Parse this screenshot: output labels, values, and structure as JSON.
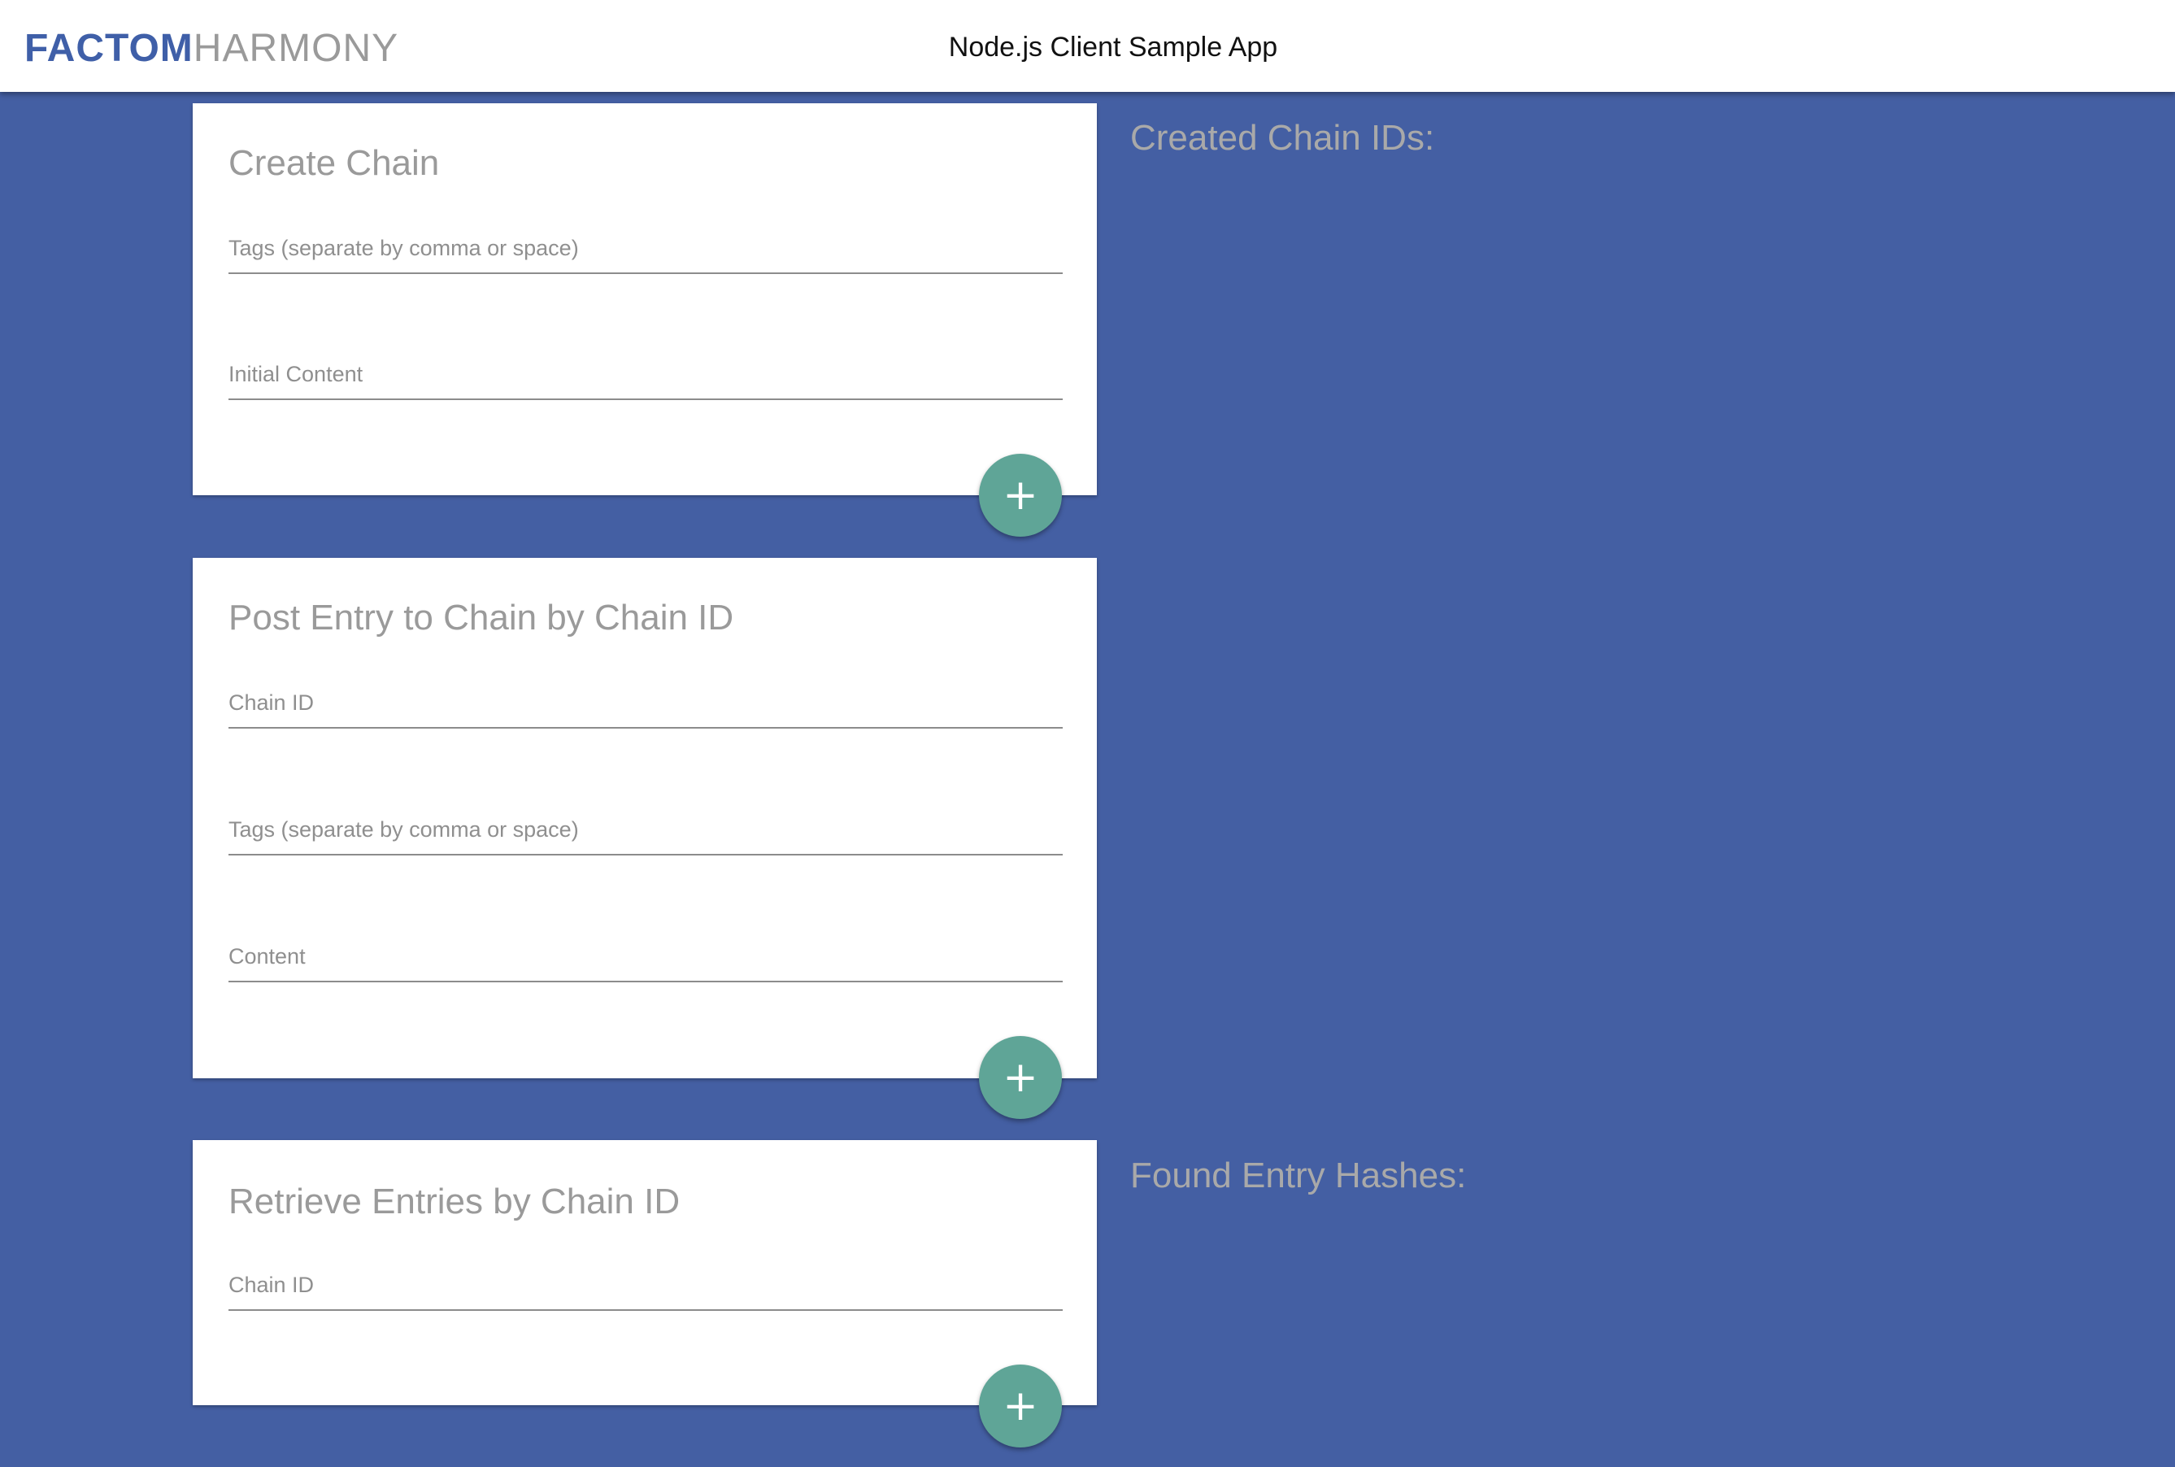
{
  "header": {
    "logo_strong": "FACTOM",
    "logo_light": "HARMONY",
    "app_title": "Node.js Client Sample App"
  },
  "create_chain": {
    "title": "Create Chain",
    "tags_placeholder": "Tags (separate by comma or space)",
    "content_placeholder": "Initial Content",
    "submit_label": "+"
  },
  "post_entry": {
    "title": "Post Entry to Chain by Chain ID",
    "chain_id_placeholder": "Chain ID",
    "tags_placeholder": "Tags (separate by comma or space)",
    "content_placeholder": "Content",
    "submit_label": "+"
  },
  "retrieve_entries": {
    "title": "Retrieve Entries by Chain ID",
    "chain_id_placeholder": "Chain ID",
    "submit_label": "+"
  },
  "results": {
    "created_chain_ids_heading": "Created Chain IDs:",
    "found_entry_hashes_heading": "Found Entry Hashes:"
  },
  "colors": {
    "background": "#445fa3",
    "brand_blue": "#3f5fa8",
    "fab_green": "#5fa597"
  }
}
